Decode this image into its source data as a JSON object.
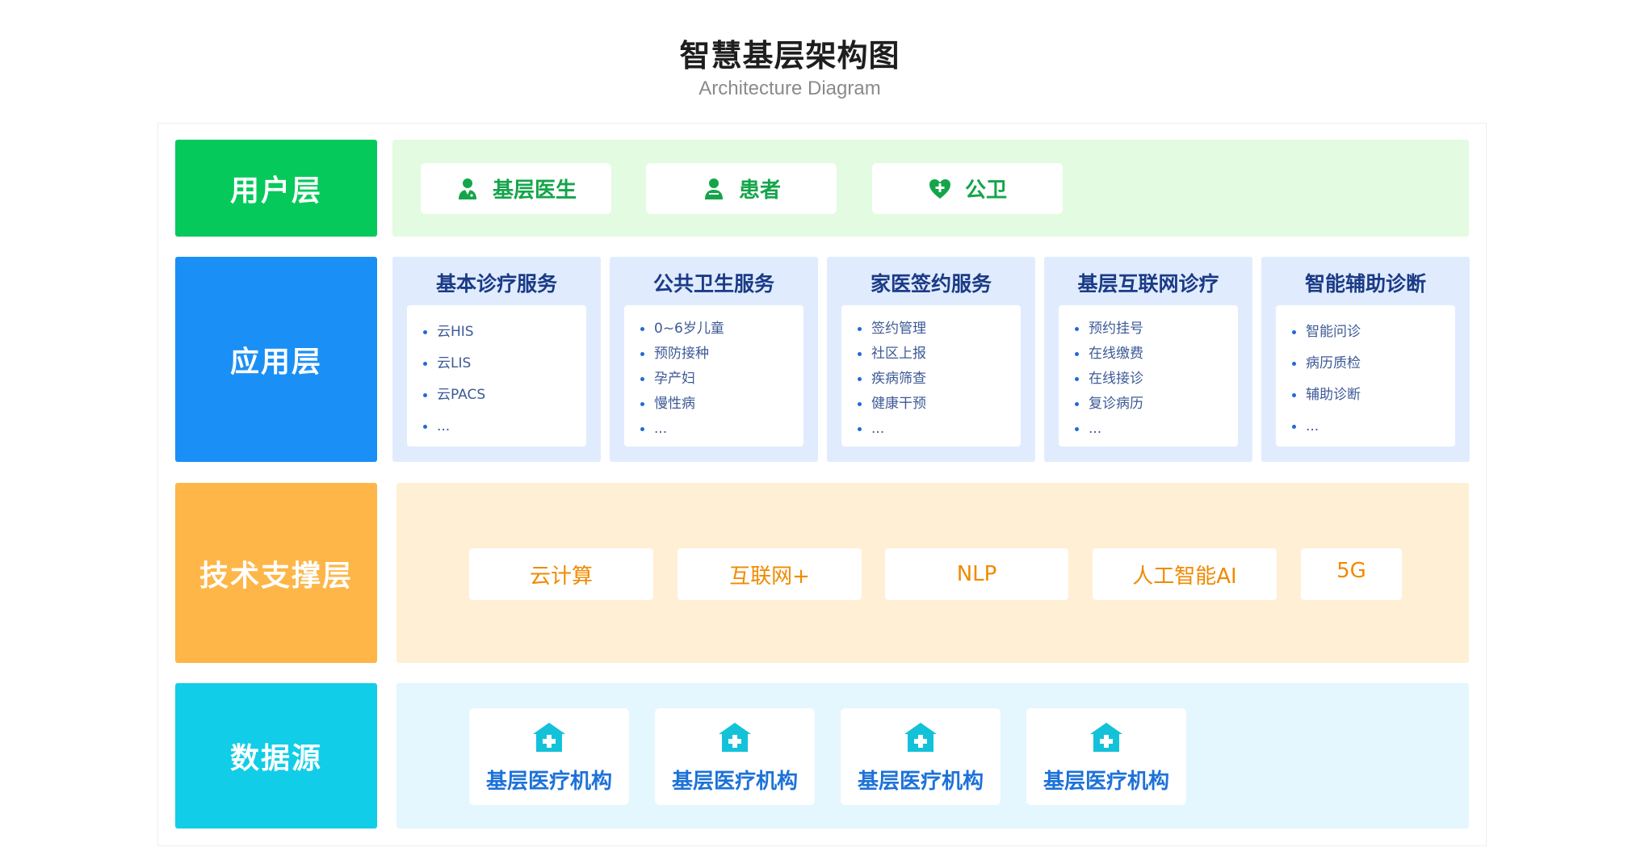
{
  "title": "智慧基层架构图",
  "subtitle": "Architecture Diagram",
  "layers": {
    "user": "用户层",
    "app": "应用层",
    "tech": "技术支撑层",
    "data": "数据源"
  },
  "user_items": [
    {
      "label": "基层医生",
      "icon": "doctor-icon"
    },
    {
      "label": "患者",
      "icon": "patient-icon"
    },
    {
      "label": "公卫",
      "icon": "heart-plus-icon"
    }
  ],
  "app_columns": [
    {
      "title": "基本诊疗服务",
      "items": [
        "云HIS",
        "云LIS",
        "云PACS",
        "..."
      ]
    },
    {
      "title": "公共卫生服务",
      "items": [
        "0~6岁儿童",
        "预防接种",
        "孕产妇",
        "慢性病",
        "..."
      ]
    },
    {
      "title": "家医签约服务",
      "items": [
        "签约管理",
        "社区上报",
        "疾病筛查",
        "健康干预",
        "..."
      ]
    },
    {
      "title": "基层互联网诊疗",
      "items": [
        "预约挂号",
        "在线缴费",
        "在线接诊",
        "复诊病历",
        "..."
      ]
    },
    {
      "title": "智能辅助诊断",
      "items": [
        "智能问诊",
        "病历质检",
        "辅助诊断",
        "..."
      ]
    }
  ],
  "tech_items": [
    "云计算",
    "互联网+",
    "NLP",
    "人工智能AI",
    "5G"
  ],
  "data_items": [
    "基层医疗机构",
    "基层医疗机构",
    "基层医疗机构",
    "基层医疗机构"
  ],
  "colors": {
    "user": "#06c95c",
    "app": "#1a8ff5",
    "tech": "#fdb647",
    "data": "#11cde8"
  }
}
